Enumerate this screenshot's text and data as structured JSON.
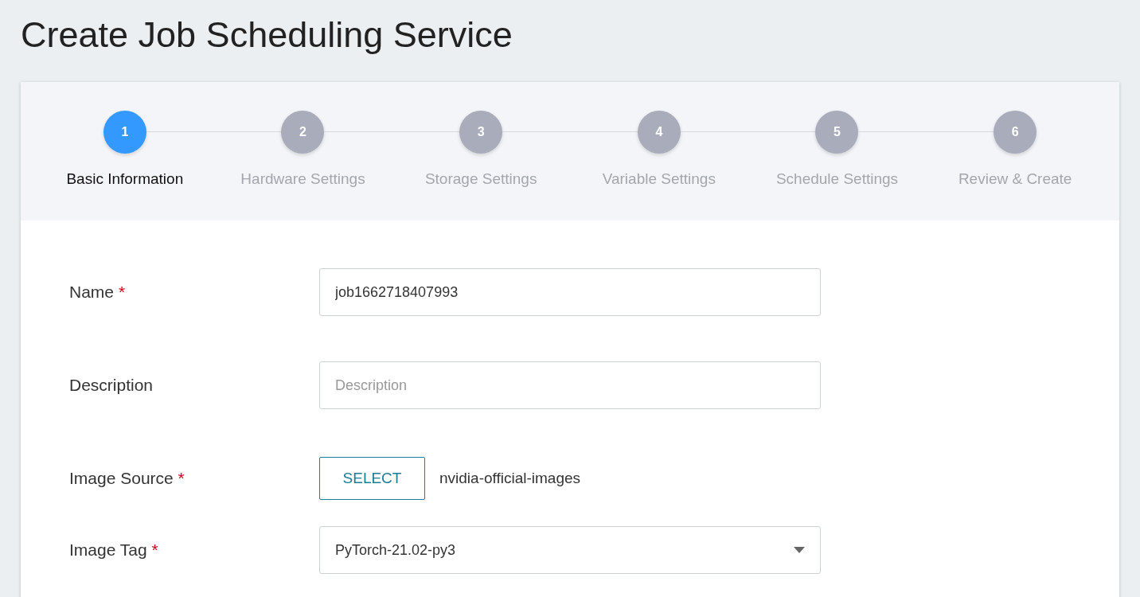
{
  "page_title": "Create Job Scheduling Service",
  "steps": [
    {
      "number": "1",
      "label": "Basic Information",
      "selected": true
    },
    {
      "number": "2",
      "label": "Hardware Settings",
      "selected": false
    },
    {
      "number": "3",
      "label": "Storage Settings",
      "selected": false
    },
    {
      "number": "4",
      "label": "Variable Settings",
      "selected": false
    },
    {
      "number": "5",
      "label": "Schedule Settings",
      "selected": false
    },
    {
      "number": "6",
      "label": "Review & Create",
      "selected": false
    }
  ],
  "form": [
    {
      "kind": "input",
      "label": "Name",
      "required_mark": "*",
      "value": "job1662718407993"
    },
    {
      "kind": "input",
      "label": "Description",
      "placeholder": "Description"
    },
    {
      "kind": "select",
      "label": "Image Source",
      "required_mark": "*",
      "button": "SELECT",
      "value": "nvidia-official-images"
    },
    {
      "kind": "dropdown",
      "label": "Image Tag",
      "required_mark": "*",
      "value": "PyTorch-21.02-py3"
    }
  ]
}
